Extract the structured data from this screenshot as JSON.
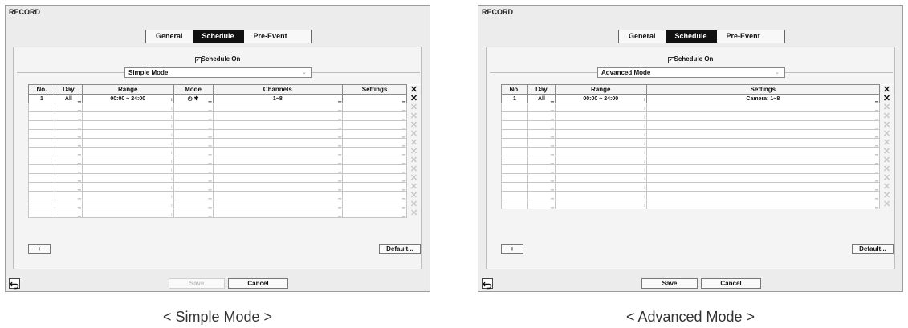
{
  "simple": {
    "title": "RECORD",
    "tabs": [
      "General",
      "Schedule",
      "Pre-Event"
    ],
    "schedule_on_label": "Schedule On",
    "mode_value": "Simple Mode",
    "columns": [
      "No.",
      "Day",
      "Range",
      "Mode",
      "Channels",
      "Settings"
    ],
    "row1": {
      "no": "1",
      "day": "All",
      "range": "00:00 ~ 24:00",
      "mode_icons": "clock-icon,motion-icon",
      "channels": "1~8",
      "settings": ""
    },
    "add_label": "+",
    "default_label": "Default...",
    "save_label": "Save",
    "cancel_label": "Cancel",
    "save_enabled": false,
    "caption": "< Simple Mode >"
  },
  "advanced": {
    "title": "RECORD",
    "tabs": [
      "General",
      "Schedule",
      "Pre-Event"
    ],
    "schedule_on_label": "Schedule On",
    "mode_value": "Advanced Mode",
    "columns": [
      "No.",
      "Day",
      "Range",
      "Settings"
    ],
    "row1": {
      "no": "1",
      "day": "All",
      "range": "00:00 ~ 24:00",
      "settings": "Camera: 1~8"
    },
    "add_label": "+",
    "default_label": "Default...",
    "save_label": "Save",
    "cancel_label": "Cancel",
    "save_enabled": true,
    "caption": "< Advanced Mode >"
  },
  "active_tab": "Schedule",
  "schedule_on_checked": true
}
